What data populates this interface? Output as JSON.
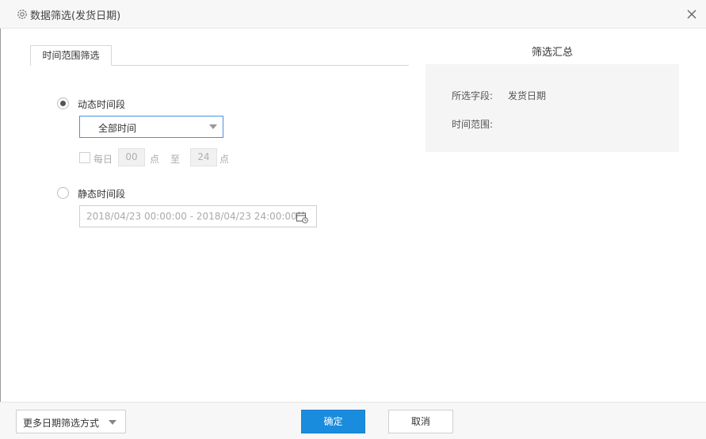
{
  "dialog": {
    "title": "数据筛选(发货日期)",
    "title_icon": "gear-icon",
    "close_icon": "close-icon"
  },
  "tabs": [
    {
      "label": "时间范围筛选",
      "active": true
    }
  ],
  "dynamic": {
    "label": "动态时间段",
    "checked": true,
    "select_value": "全部时间",
    "daily": {
      "checkbox_label": "每日",
      "checked": false,
      "from_value": "00",
      "from_unit": "点",
      "to_label": "至",
      "to_value": "24",
      "to_unit": "点"
    }
  },
  "static": {
    "label": "静态时间段",
    "checked": false,
    "range_placeholder": "2018/04/23 00:00:00 - 2018/04/23 24:00:00",
    "calendar_icon": "calendar-icon"
  },
  "summary": {
    "title": "筛选汇总",
    "field_label": "所选字段:",
    "field_value": "发货日期",
    "range_label": "时间范围:",
    "range_value": ""
  },
  "footer": {
    "more_label": "更多日期筛选方式",
    "ok_label": "确定",
    "cancel_label": "取消"
  },
  "colors": {
    "primary": "#1a8cde",
    "select_border": "#4a90e2",
    "summary_bg": "#f5f5f5"
  }
}
